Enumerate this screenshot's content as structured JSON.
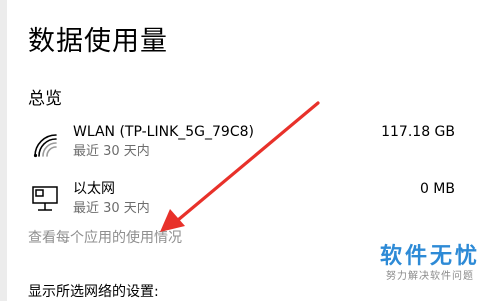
{
  "page": {
    "title": "数据使用量",
    "section_title": "总览"
  },
  "networks": [
    {
      "name": "WLAN (TP-LINK_5G_79C8)",
      "period": "最近 30 天内",
      "usage": "117.18 GB",
      "icon": "wifi-icon"
    },
    {
      "name": "以太网",
      "period": "最近 30 天内",
      "usage": "0 MB",
      "icon": "ethernet-icon"
    }
  ],
  "links": {
    "per_app_usage": "查看每个应用的使用情况"
  },
  "settings": {
    "label": "显示所选网络的设置:"
  },
  "watermark": {
    "title": "软件无忧",
    "subtitle": "努力解决软件问题"
  },
  "colors": {
    "arrow": "#e8312a",
    "watermark_blue": "#2d8ad6",
    "link_gray": "#8f8f8f"
  }
}
